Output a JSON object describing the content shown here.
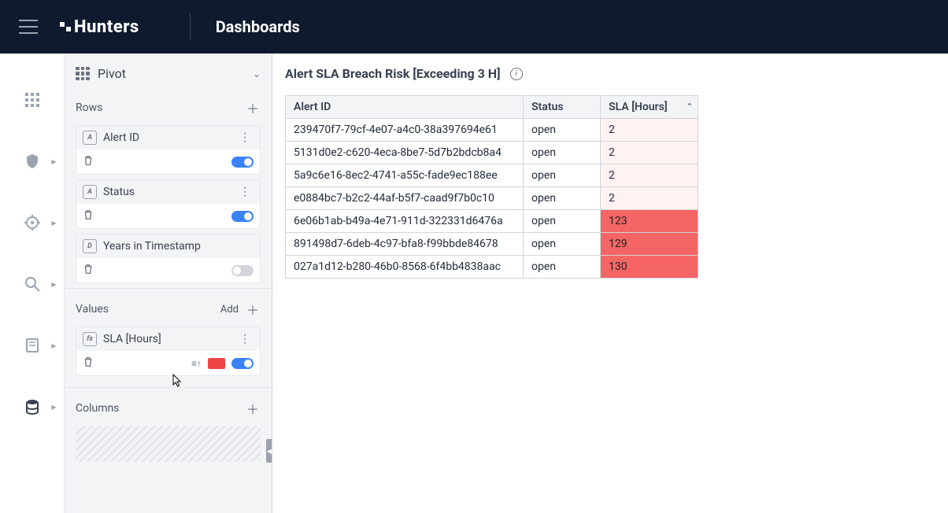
{
  "header": {
    "logo_text": "Hunters",
    "page_title": "Dashboards"
  },
  "pivot": {
    "panel_label": "Pivot",
    "rows_label": "Rows",
    "values_label": "Values",
    "values_add_label": "Add",
    "columns_label": "Columns",
    "fields": {
      "row1": {
        "type": "A",
        "name": "Alert ID",
        "toggle": true
      },
      "row2": {
        "type": "A",
        "name": "Status",
        "toggle": true
      },
      "row3": {
        "type": "D",
        "name": "Years in Timestamp",
        "toggle": false
      },
      "val1": {
        "type": "fx",
        "name": "SLA [Hours]",
        "toggle": true,
        "color": "#ef4444"
      }
    }
  },
  "chart_title": "Alert SLA Breach Risk [Exceeding 3 H]",
  "chart_data": {
    "type": "table",
    "columns": [
      "Alert ID",
      "Status",
      "SLA [Hours]"
    ],
    "sort": {
      "column": "SLA [Hours]",
      "direction": "asc"
    },
    "rows": [
      {
        "id": "239470f7-79cf-4e07-a4c0-38a397694e61",
        "status": "open",
        "sla": 2,
        "highlight": "pale"
      },
      {
        "id": "5131d0e2-c620-4eca-8be7-5d7b2bdcb8a4",
        "status": "open",
        "sla": 2,
        "highlight": "pale"
      },
      {
        "id": "5a9c6e16-8ec2-4741-a55c-fade9ec188ee",
        "status": "open",
        "sla": 2,
        "highlight": "pale"
      },
      {
        "id": "e0884bc7-b2c2-44af-b5f7-caad9f7b0c10",
        "status": "open",
        "sla": 2,
        "highlight": "pale"
      },
      {
        "id": "6e06b1ab-b49a-4e71-911d-322331d6476a",
        "status": "open",
        "sla": 123,
        "highlight": "red"
      },
      {
        "id": "891498d7-6deb-4c97-bfa8-f99bbde84678",
        "status": "open",
        "sla": 129,
        "highlight": "red"
      },
      {
        "id": "027a1d12-b280-46b0-8568-6f4bb4838aac",
        "status": "open",
        "sla": 130,
        "highlight": "red"
      }
    ]
  },
  "colors": {
    "accent": "#3b82f6",
    "danger": "#ef4444"
  }
}
